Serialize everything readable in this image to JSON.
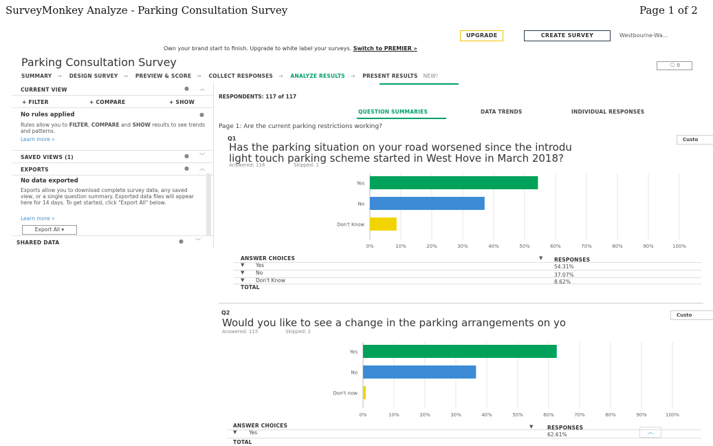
{
  "print": {
    "title": "SurveyMonkey Analyze - Parking Consultation Survey",
    "page": "Page 1 of 2"
  },
  "topbar": {
    "upgrade": "UPGRADE",
    "create_survey": "CREATE SURVEY",
    "account": "Westbourne-Wa..."
  },
  "banner": {
    "text": "Own your brand start to finish. Upgrade to white label your surveys.",
    "link": "Switch to PREMIER »"
  },
  "survey_title": "Parking Consultation Survey",
  "comment_count": "0",
  "nav": {
    "items": [
      "SUMMARY",
      "DESIGN SURVEY",
      "PREVIEW & SCORE",
      "COLLECT RESPONSES",
      "ANALYZE RESULTS",
      "PRESENT RESULTS"
    ],
    "new_tag": "NEW!",
    "arrow": "→"
  },
  "sidebar": {
    "current_view": "CURRENT VIEW",
    "filter": "+ FILTER",
    "compare": "+ COMPARE",
    "show": "+ SHOW",
    "no_rules": "No rules applied",
    "rules_pre": "Rules allow you to ",
    "rules_filter": "FILTER",
    "rules_comma": ", ",
    "rules_compare": "COMPARE",
    "rules_and": " and ",
    "rules_show": "SHOW",
    "rules_post": " results to see trends and patterns.",
    "learn_more": "Learn more »",
    "saved_views": "SAVED VIEWS (1)",
    "exports": "EXPORTS",
    "no_data_exported": "No data exported",
    "exports_text": "Exports allow you to download complete survey data, any saved view, or a single question summary. Exported data files will appear here for 14 days. To get started, click \"Export All\" below.",
    "learn_more_2": "Learn more »",
    "export_all": "Export All ▾",
    "shared_data": "SHARED DATA"
  },
  "respondents": "RESPONDENTS: 117 of 117",
  "tabs": [
    "QUESTION SUMMARIES",
    "DATA TRENDS",
    "INDIVIDUAL RESPONSES"
  ],
  "page_label": "Page 1: Are the current parking restrictions working?",
  "questions": [
    {
      "num": "Q1",
      "text_line1": "Has the parking situation on your road worsened since the introdu",
      "text_line2": "light touch parking scheme started in West Hove in March 2018?",
      "answered": "Answered: 116",
      "skipped": "Skipped: 1",
      "custom_btn": "Custo",
      "table_head_choices": "ANSWER CHOICES",
      "table_head_responses": "RESPONSES",
      "rows": [
        {
          "choice": "Yes",
          "response": "54.31%"
        },
        {
          "choice": "No",
          "response": "37.07%"
        },
        {
          "choice": "Don't Know",
          "response": "8.62%"
        }
      ],
      "total": "TOTAL"
    },
    {
      "num": "Q2",
      "text_line1": "Would you like to see a change in the parking arrangements on yo",
      "answered": "Answered: 115",
      "skipped": "Skipped: 2",
      "custom_btn": "Custo",
      "table_head_choices": "ANSWER CHOICES",
      "table_head_responses": "RESPONSES",
      "rows": [
        {
          "choice": "Yes",
          "response": "62.61%"
        }
      ],
      "total": "TOTAL"
    }
  ],
  "chart_data": [
    {
      "type": "bar",
      "orientation": "horizontal",
      "categories": [
        "Yes",
        "No",
        "Don't Know"
      ],
      "values": [
        54.31,
        37.07,
        8.62
      ],
      "colors": [
        "#00a15a",
        "#3d8bd6",
        "#f2d400"
      ],
      "xlim": [
        0,
        100
      ],
      "ticks": [
        "0%",
        "10%",
        "20%",
        "30%",
        "40%",
        "50%",
        "60%",
        "70%",
        "80%",
        "90%",
        "100%"
      ],
      "grid": true
    },
    {
      "type": "bar",
      "orientation": "horizontal",
      "categories": [
        "Yes",
        "No",
        "Don't now"
      ],
      "values": [
        62.61,
        36.52,
        0.87
      ],
      "colors": [
        "#00a15a",
        "#3d8bd6",
        "#f2d400"
      ],
      "xlim": [
        0,
        100
      ],
      "ticks": [
        "0%",
        "10%",
        "20%",
        "30%",
        "40%",
        "50%",
        "60%",
        "70%",
        "80%",
        "90%",
        "100%"
      ],
      "grid": true
    }
  ],
  "icons": {
    "gear": "gear-icon",
    "chevron_up": "chevron-up-icon",
    "chevron_down": "chevron-down-icon",
    "caret_down": "caret-down-icon",
    "comment": "comment-icon",
    "info": "info-icon"
  },
  "colors": {
    "accent_green": "#00a06a",
    "bar_green": "#00a15a",
    "bar_blue": "#3d8bd6",
    "bar_yellow": "#f2d400",
    "upgrade_border": "#f2c200"
  }
}
